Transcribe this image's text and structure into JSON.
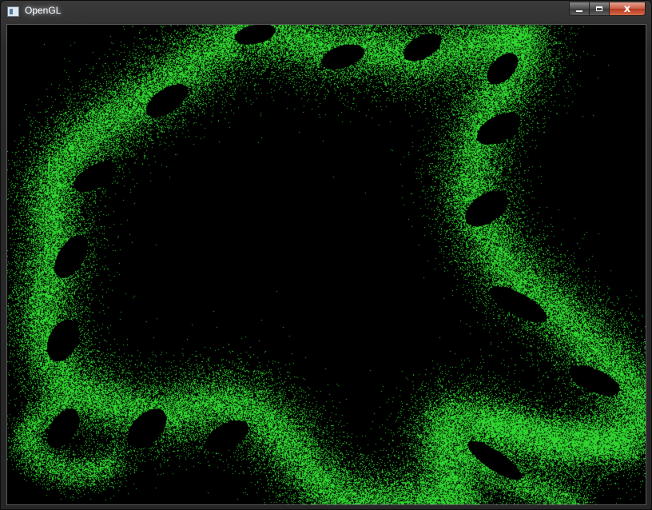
{
  "window": {
    "title": "OpenGL",
    "icon": "opengl-app-icon",
    "controls": {
      "minimize_icon": "minimize-icon",
      "maximize_icon": "maximize-icon",
      "close_icon": "close-icon",
      "close_glyph": "x"
    }
  },
  "render": {
    "background_color": "#000000",
    "point_color": "#2fd42f",
    "description_free": true
  }
}
